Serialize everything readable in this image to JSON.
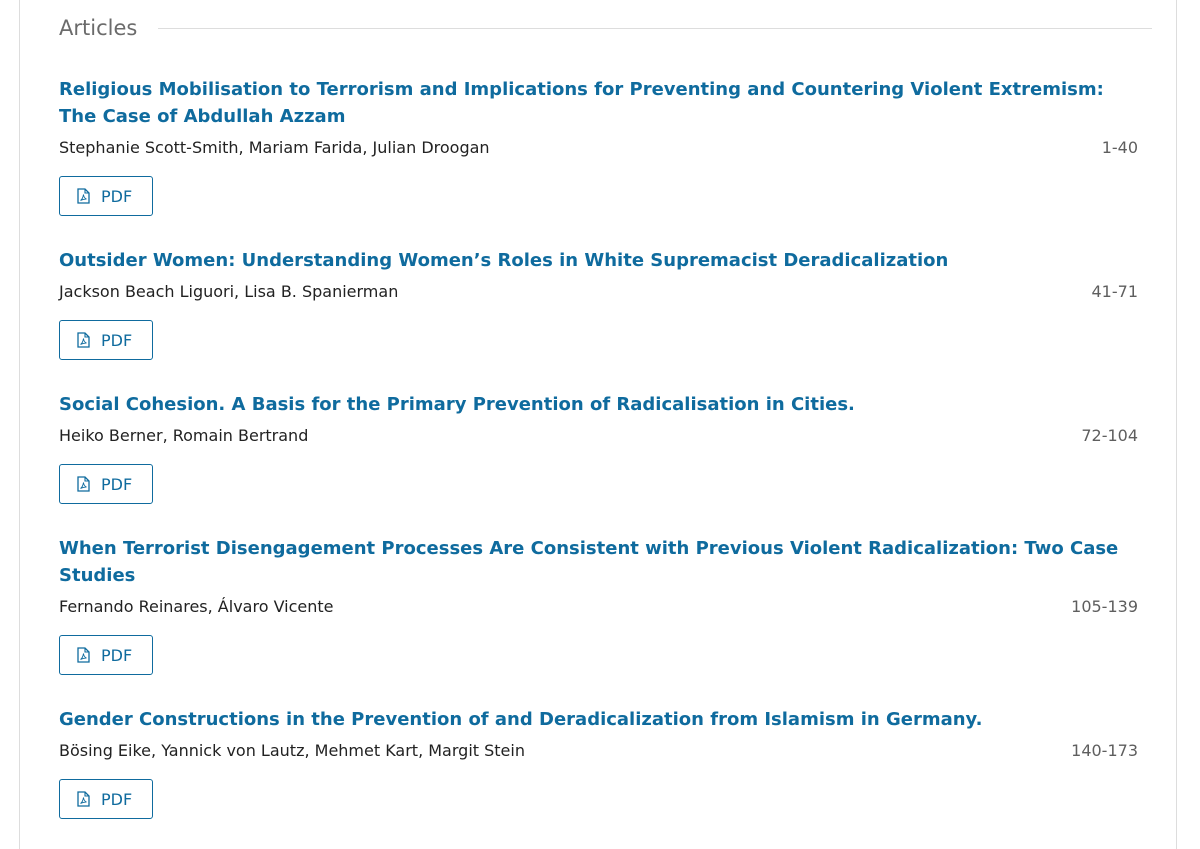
{
  "section": {
    "heading": "Articles"
  },
  "articles": [
    {
      "title": "Religious Mobilisation to Terrorism and Implications for Preventing and Countering Violent Extremism: The Case of Abdullah Azzam",
      "authors": "Stephanie Scott-Smith, Mariam Farida, Julian Droogan",
      "pages": "1-40",
      "galley_label": "PDF"
    },
    {
      "title": "Outsider Women: Understanding Women’s Roles in White Supremacist Deradicalization",
      "authors": "Jackson Beach Liguori, Lisa B. Spanierman",
      "pages": "41-71",
      "galley_label": "PDF"
    },
    {
      "title": "Social Cohesion. A Basis for the Primary Prevention of Radicalisation in Cities.",
      "authors": "Heiko Berner, Romain Bertrand",
      "pages": "72-104",
      "galley_label": "PDF"
    },
    {
      "title": "When Terrorist Disengagement Processes Are Consistent with Previous Violent Radicalization: Two Case Studies",
      "authors": "Fernando Reinares, Álvaro Vicente",
      "pages": "105-139",
      "galley_label": "PDF"
    },
    {
      "title": "Gender Constructions in the Prevention of and Deradicalization from Islamism in Germany.",
      "authors": "Bösing Eike, Yannick von Lautz, Mehmet Kart, Margit Stein",
      "pages": "140-173",
      "galley_label": "PDF"
    }
  ],
  "icons": {
    "galley": "file-pdf-icon"
  },
  "colors": {
    "link": "#0f6b9e",
    "heading": "#6b6b6b",
    "text": "#222222",
    "pages": "#5e5e5e",
    "rule": "#dddddd"
  }
}
